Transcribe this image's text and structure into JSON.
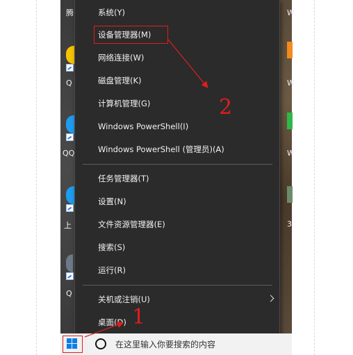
{
  "desktop": {
    "left_labels": [
      "腾",
      "Q",
      "QQ",
      "上",
      "Q"
    ],
    "right_labels": [
      "W",
      "W",
      "W",
      "3"
    ]
  },
  "menu": {
    "items": [
      {
        "label": "系统(Y)"
      },
      {
        "label": "设备管理器(M)"
      },
      {
        "label": "网络连接(W)"
      },
      {
        "label": "磁盘管理(K)"
      },
      {
        "label": "计算机管理(G)"
      },
      {
        "label": "Windows PowerShell(I)"
      },
      {
        "label": "Windows PowerShell (管理员)(A)"
      },
      {
        "label": "任务管理器(T)"
      },
      {
        "label": "设置(N)"
      },
      {
        "label": "文件资源管理器(E)"
      },
      {
        "label": "搜索(S)"
      },
      {
        "label": "运行(R)"
      },
      {
        "label": "关机或注销(U)"
      },
      {
        "label": "桌面(D)"
      }
    ]
  },
  "taskbar": {
    "search_placeholder": "在这里输入你要搜索的内容"
  },
  "annotations": {
    "step1": "1",
    "step2": "2"
  },
  "colors": {
    "menu_bg": "#2b2b2b",
    "annotation": "#e01e1e",
    "windows_blue": "#0a7ee8"
  }
}
